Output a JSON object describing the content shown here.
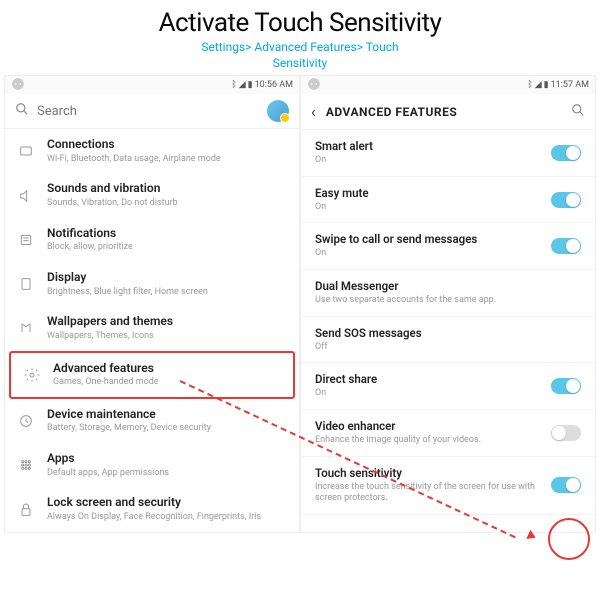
{
  "header": {
    "title": "Activate Touch Sensitivity",
    "breadcrumb_line1": "Settings> Advanced Features> Touch",
    "breadcrumb_line2": "Sensitivity"
  },
  "phone_left": {
    "status": {
      "time": "10:56 AM"
    },
    "search_placeholder": "Search",
    "items": [
      {
        "title": "Connections",
        "sub": "Wi-Fi, Bluetooth, Data usage, Airplane mode"
      },
      {
        "title": "Sounds and vibration",
        "sub": "Sounds, Vibration, Do not disturb"
      },
      {
        "title": "Notifications",
        "sub": "Block, allow, prioritize"
      },
      {
        "title": "Display",
        "sub": "Brightness, Blue light filter, Home screen"
      },
      {
        "title": "Wallpapers and themes",
        "sub": "Wallpapers, Themes, Icons"
      },
      {
        "title": "Advanced features",
        "sub": "Games, One-handed mode"
      },
      {
        "title": "Device maintenance",
        "sub": "Battery, Storage, Memory, Device security"
      },
      {
        "title": "Apps",
        "sub": "Default apps, App permissions"
      },
      {
        "title": "Lock screen and security",
        "sub": "Always On Display, Face Recognition, Fingerprints, Iris"
      }
    ]
  },
  "phone_right": {
    "status": {
      "time": "11:57 AM"
    },
    "topbar_title": "ADVANCED FEATURES",
    "items": [
      {
        "title": "Smart alert",
        "sub": "On",
        "toggle": "on"
      },
      {
        "title": "Easy mute",
        "sub": "On",
        "toggle": "on"
      },
      {
        "title": "Swipe to call or send messages",
        "sub": "On",
        "toggle": "on"
      },
      {
        "title": "Dual Messenger",
        "sub": "Use two separate accounts for the same app.",
        "toggle": null
      },
      {
        "title": "Send SOS messages",
        "sub": "Off",
        "toggle": null
      },
      {
        "title": "Direct share",
        "sub": "On",
        "toggle": "on"
      },
      {
        "title": "Video enhancer",
        "sub": "Enhance the image quality of your videos.",
        "toggle": "off"
      },
      {
        "title": "Touch sensitivity",
        "sub": "Increase the touch sensitivity of the screen for use with screen protectors.",
        "toggle": "on"
      }
    ]
  }
}
